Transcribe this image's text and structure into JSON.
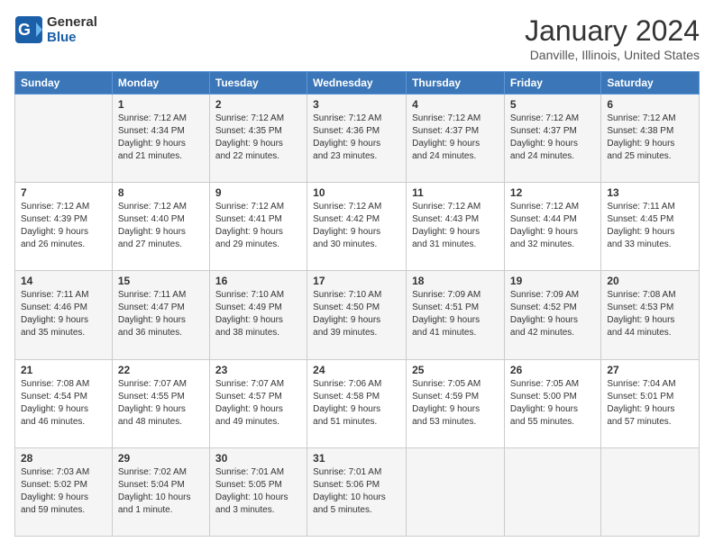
{
  "logo": {
    "text1": "General",
    "text2": "Blue"
  },
  "title": "January 2024",
  "subtitle": "Danville, Illinois, United States",
  "headers": [
    "Sunday",
    "Monday",
    "Tuesday",
    "Wednesday",
    "Thursday",
    "Friday",
    "Saturday"
  ],
  "weeks": [
    [
      {
        "day": "",
        "info": ""
      },
      {
        "day": "1",
        "info": "Sunrise: 7:12 AM\nSunset: 4:34 PM\nDaylight: 9 hours\nand 21 minutes."
      },
      {
        "day": "2",
        "info": "Sunrise: 7:12 AM\nSunset: 4:35 PM\nDaylight: 9 hours\nand 22 minutes."
      },
      {
        "day": "3",
        "info": "Sunrise: 7:12 AM\nSunset: 4:36 PM\nDaylight: 9 hours\nand 23 minutes."
      },
      {
        "day": "4",
        "info": "Sunrise: 7:12 AM\nSunset: 4:37 PM\nDaylight: 9 hours\nand 24 minutes."
      },
      {
        "day": "5",
        "info": "Sunrise: 7:12 AM\nSunset: 4:37 PM\nDaylight: 9 hours\nand 24 minutes."
      },
      {
        "day": "6",
        "info": "Sunrise: 7:12 AM\nSunset: 4:38 PM\nDaylight: 9 hours\nand 25 minutes."
      }
    ],
    [
      {
        "day": "7",
        "info": "Sunrise: 7:12 AM\nSunset: 4:39 PM\nDaylight: 9 hours\nand 26 minutes."
      },
      {
        "day": "8",
        "info": "Sunrise: 7:12 AM\nSunset: 4:40 PM\nDaylight: 9 hours\nand 27 minutes."
      },
      {
        "day": "9",
        "info": "Sunrise: 7:12 AM\nSunset: 4:41 PM\nDaylight: 9 hours\nand 29 minutes."
      },
      {
        "day": "10",
        "info": "Sunrise: 7:12 AM\nSunset: 4:42 PM\nDaylight: 9 hours\nand 30 minutes."
      },
      {
        "day": "11",
        "info": "Sunrise: 7:12 AM\nSunset: 4:43 PM\nDaylight: 9 hours\nand 31 minutes."
      },
      {
        "day": "12",
        "info": "Sunrise: 7:12 AM\nSunset: 4:44 PM\nDaylight: 9 hours\nand 32 minutes."
      },
      {
        "day": "13",
        "info": "Sunrise: 7:11 AM\nSunset: 4:45 PM\nDaylight: 9 hours\nand 33 minutes."
      }
    ],
    [
      {
        "day": "14",
        "info": "Sunrise: 7:11 AM\nSunset: 4:46 PM\nDaylight: 9 hours\nand 35 minutes."
      },
      {
        "day": "15",
        "info": "Sunrise: 7:11 AM\nSunset: 4:47 PM\nDaylight: 9 hours\nand 36 minutes."
      },
      {
        "day": "16",
        "info": "Sunrise: 7:10 AM\nSunset: 4:49 PM\nDaylight: 9 hours\nand 38 minutes."
      },
      {
        "day": "17",
        "info": "Sunrise: 7:10 AM\nSunset: 4:50 PM\nDaylight: 9 hours\nand 39 minutes."
      },
      {
        "day": "18",
        "info": "Sunrise: 7:09 AM\nSunset: 4:51 PM\nDaylight: 9 hours\nand 41 minutes."
      },
      {
        "day": "19",
        "info": "Sunrise: 7:09 AM\nSunset: 4:52 PM\nDaylight: 9 hours\nand 42 minutes."
      },
      {
        "day": "20",
        "info": "Sunrise: 7:08 AM\nSunset: 4:53 PM\nDaylight: 9 hours\nand 44 minutes."
      }
    ],
    [
      {
        "day": "21",
        "info": "Sunrise: 7:08 AM\nSunset: 4:54 PM\nDaylight: 9 hours\nand 46 minutes."
      },
      {
        "day": "22",
        "info": "Sunrise: 7:07 AM\nSunset: 4:55 PM\nDaylight: 9 hours\nand 48 minutes."
      },
      {
        "day": "23",
        "info": "Sunrise: 7:07 AM\nSunset: 4:57 PM\nDaylight: 9 hours\nand 49 minutes."
      },
      {
        "day": "24",
        "info": "Sunrise: 7:06 AM\nSunset: 4:58 PM\nDaylight: 9 hours\nand 51 minutes."
      },
      {
        "day": "25",
        "info": "Sunrise: 7:05 AM\nSunset: 4:59 PM\nDaylight: 9 hours\nand 53 minutes."
      },
      {
        "day": "26",
        "info": "Sunrise: 7:05 AM\nSunset: 5:00 PM\nDaylight: 9 hours\nand 55 minutes."
      },
      {
        "day": "27",
        "info": "Sunrise: 7:04 AM\nSunset: 5:01 PM\nDaylight: 9 hours\nand 57 minutes."
      }
    ],
    [
      {
        "day": "28",
        "info": "Sunrise: 7:03 AM\nSunset: 5:02 PM\nDaylight: 9 hours\nand 59 minutes."
      },
      {
        "day": "29",
        "info": "Sunrise: 7:02 AM\nSunset: 5:04 PM\nDaylight: 10 hours\nand 1 minute."
      },
      {
        "day": "30",
        "info": "Sunrise: 7:01 AM\nSunset: 5:05 PM\nDaylight: 10 hours\nand 3 minutes."
      },
      {
        "day": "31",
        "info": "Sunrise: 7:01 AM\nSunset: 5:06 PM\nDaylight: 10 hours\nand 5 minutes."
      },
      {
        "day": "",
        "info": ""
      },
      {
        "day": "",
        "info": ""
      },
      {
        "day": "",
        "info": ""
      }
    ]
  ]
}
